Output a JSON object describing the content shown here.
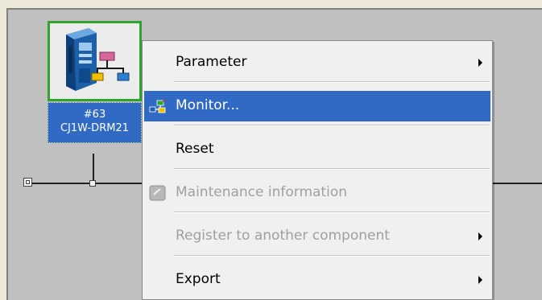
{
  "network": {
    "device": {
      "node_label": "#63",
      "model_label": "CJ1W-DRM21"
    }
  },
  "context_menu": {
    "items": [
      {
        "label": "Parameter",
        "mnemonic": "P",
        "has_submenu": true,
        "disabled": false,
        "selected": false
      },
      {
        "label": "Monitor...",
        "mnemonic": "M",
        "has_submenu": false,
        "disabled": false,
        "selected": true,
        "icon": "monitor-network-icon"
      },
      {
        "label": "Reset",
        "mnemonic": "R",
        "has_submenu": false,
        "disabled": false,
        "selected": false
      },
      {
        "label": "Maintenance information",
        "mnemonic": "M",
        "has_submenu": false,
        "disabled": true,
        "selected": false,
        "icon": "maintenance-icon"
      },
      {
        "label": "Register to another component",
        "has_submenu": true,
        "disabled": true,
        "selected": false
      },
      {
        "label": "Export",
        "mnemonic": "E",
        "has_submenu": true,
        "disabled": false,
        "selected": false
      }
    ]
  },
  "colors": {
    "selection": "#316ac5",
    "device_frame": "#2fa52f",
    "canvas": "#c0c0c0",
    "menu_bg": "#f0f0f0",
    "disabled_text": "#a0a0a0"
  }
}
